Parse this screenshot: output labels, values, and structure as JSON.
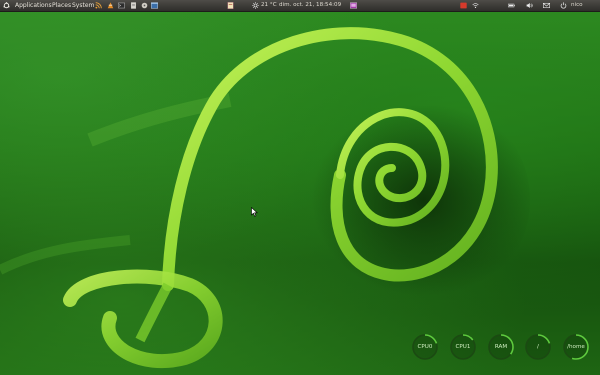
{
  "panel": {
    "menus": [
      "Applications",
      "Places",
      "System"
    ],
    "weather": "21 °C",
    "datetime": "dim. oct. 21, 18:54:09",
    "user": "nico",
    "launcher_icons": [
      "rss-icon",
      "vlc-icon",
      "terminal-icon",
      "document-icon",
      "disk-icon",
      "circle-app-icon",
      "window-icon"
    ],
    "tray_icons": [
      "note-icon",
      "sun-icon",
      "screen-icon",
      "recording-icon",
      "wifi-icon",
      "battery-icon",
      "volume-icon",
      "mail-icon",
      "power-icon"
    ]
  },
  "conky": [
    {
      "label": "CPU0",
      "value": 0.2
    },
    {
      "label": "CPU1",
      "value": 0.15
    },
    {
      "label": "RAM",
      "value": 0.35
    },
    {
      "label": "/",
      "value": 0.2
    },
    {
      "label": "/home",
      "value": 0.55
    }
  ],
  "colors": {
    "panel": "#3c3b37",
    "ring": "#5ecb3e",
    "ring_track": "#1b4a12",
    "tendril": "#9be23a",
    "accent_red": "#d63a2b"
  }
}
